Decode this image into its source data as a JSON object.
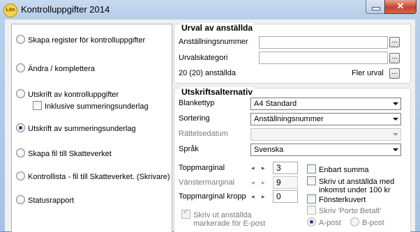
{
  "window": {
    "title": "Kontrolluppgifter 2014",
    "app_icon_text": "Lön",
    "close_label": "✕"
  },
  "left": {
    "items": [
      {
        "label": "Skapa register för kontrolluppgifter",
        "checked": false
      },
      {
        "label": "Ändra / komplettera",
        "checked": false
      },
      {
        "label": "Utskrift av kontrolluppgifter",
        "checked": false
      },
      {
        "label": "Utskrift av summeringsunderlag",
        "checked": true
      },
      {
        "label": "Skapa fil till Skatteverket",
        "checked": false
      },
      {
        "label": "Kontrollista - fil till Skatteverket. (Skrivare)",
        "checked": false
      },
      {
        "label": "Statusrapport",
        "checked": false
      }
    ],
    "sub_checkbox": "Inklusive summeringsunderlag"
  },
  "urval": {
    "title": "Urval av anställda",
    "anstnr_label": "Anställningsnummer",
    "kategori_label": "Urvalskategori",
    "count_text": "20 (20) anställda",
    "more_label": "Fler urval",
    "dots": "..."
  },
  "utskrift": {
    "title": "Utskriftsalternativ",
    "blankett_label": "Blankettyp",
    "blankett_value": "A4 Standard",
    "sortering_label": "Sortering",
    "sortering_value": "Anställningsnummer",
    "rattelse_label": "Rättelsedatum",
    "sprak_label": "Språk",
    "sprak_value": "Svenska",
    "top_label": "Toppmarginal",
    "top_value": "3",
    "left_label": "Vänstermarginal",
    "left_value": "9",
    "kropp_label": "Toppmarginal kropp",
    "kropp_value": "0",
    "enbart_summa": "Enbart summa",
    "skriv_inkomst_1": "Skriv ut anställda med",
    "skriv_inkomst_2": "inkomst under 100 kr",
    "fonsterkuvert": "Fönsterkuvert",
    "porto_label": "Skriv 'Porto Betalt'",
    "apost": "A-post",
    "bpost": "B-post",
    "email_1": "Skriv ut anställda",
    "email_2": "markerade för E-post",
    "spin_left": "◂",
    "spin_right": "▸"
  }
}
